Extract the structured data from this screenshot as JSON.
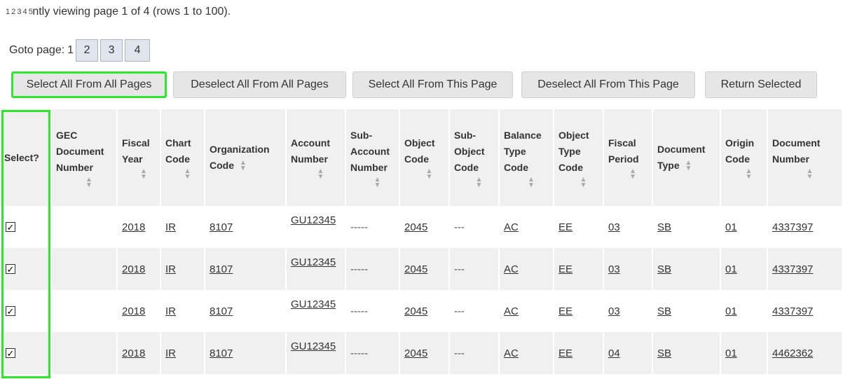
{
  "pager": {
    "tiny_pages": "1 2 3 4 5",
    "status_text": "ntly viewing page 1 of 4 (rows 1 to 100).",
    "goto_label": "Goto page:",
    "current_page": "1",
    "pages": [
      "2",
      "3",
      "4"
    ]
  },
  "actions": {
    "select_all_pages": "Select All From All Pages",
    "deselect_all_pages": "Deselect All From All Pages",
    "select_all_this_page": "Select All From This Page",
    "deselect_all_this_page": "Deselect All From This Page",
    "return_selected": "Return Selected"
  },
  "table": {
    "headers": {
      "select": "Select?",
      "gec_document_number": [
        "GEC",
        "Document",
        "Number"
      ],
      "fiscal_year": [
        "Fiscal",
        "Year"
      ],
      "chart_code": [
        "Chart",
        "Code"
      ],
      "organization_code": [
        "Organization",
        "Code"
      ],
      "account_number": [
        "Account",
        "Number"
      ],
      "sub_account_number": [
        "Sub-",
        "Account",
        "Number"
      ],
      "object_code": [
        "Object",
        "Code"
      ],
      "sub_object_code": [
        "Sub-",
        "Object",
        "Code"
      ],
      "balance_type_code": [
        "Balance",
        "Type",
        "Code"
      ],
      "object_type_code": [
        "Object",
        "Type",
        "Code"
      ],
      "fiscal_period": [
        "Fiscal",
        "Period"
      ],
      "document_type": [
        "Document",
        "Type"
      ],
      "origin_code": [
        "Origin",
        "Code"
      ],
      "document_number": [
        "Document",
        "Number"
      ]
    },
    "rows": [
      {
        "checked": true,
        "gec": "",
        "fiscal_year": "2018",
        "chart": "IR",
        "org": "8107",
        "account": "GU12345",
        "sub_account": "-----",
        "object": "2045",
        "sub_object": "---",
        "balance_type": "AC",
        "object_type": "EE",
        "period": "03",
        "doc_type": "SB",
        "origin": "01",
        "doc_number": "4337397"
      },
      {
        "checked": true,
        "gec": "",
        "fiscal_year": "2018",
        "chart": "IR",
        "org": "8107",
        "account": "GU12345",
        "sub_account": "-----",
        "object": "2045",
        "sub_object": "---",
        "balance_type": "AC",
        "object_type": "EE",
        "period": "03",
        "doc_type": "SB",
        "origin": "01",
        "doc_number": "4337397"
      },
      {
        "checked": true,
        "gec": "",
        "fiscal_year": "2018",
        "chart": "IR",
        "org": "8107",
        "account": "GU12345",
        "sub_account": "-----",
        "object": "2045",
        "sub_object": "---",
        "balance_type": "AC",
        "object_type": "EE",
        "period": "03",
        "doc_type": "SB",
        "origin": "01",
        "doc_number": "4337397"
      },
      {
        "checked": true,
        "gec": "",
        "fiscal_year": "2018",
        "chart": "IR",
        "org": "8107",
        "account": "GU12345",
        "sub_account": "-----",
        "object": "2045",
        "sub_object": "---",
        "balance_type": "AC",
        "object_type": "EE",
        "period": "04",
        "doc_type": "SB",
        "origin": "01",
        "doc_number": "4462362"
      }
    ]
  },
  "highlight_color": "#2fe62f"
}
